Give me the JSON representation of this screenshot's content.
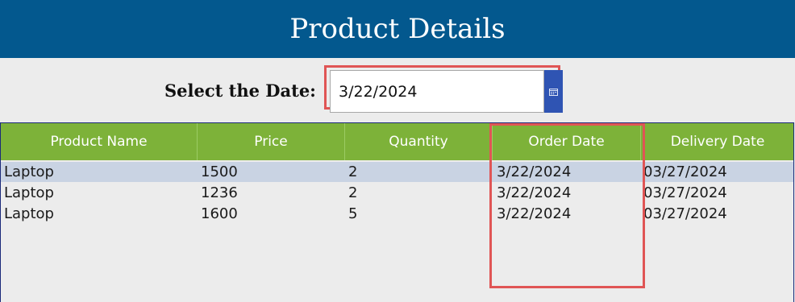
{
  "header": {
    "title": "Product Details"
  },
  "date_filter": {
    "label": "Select the Date:",
    "value": "3/22/2024"
  },
  "grid": {
    "columns": [
      "Product Name",
      "Price",
      "Quantity",
      "Order Date",
      "Delivery Date"
    ],
    "rows": [
      [
        "Laptop",
        "1500",
        "2",
        "3/22/2024",
        "03/27/2024"
      ],
      [
        "Laptop",
        "1236",
        "2",
        "3/22/2024",
        "03/27/2024"
      ],
      [
        "Laptop",
        "1600",
        "5",
        "3/22/2024",
        "03/27/2024"
      ]
    ]
  },
  "colors": {
    "header_bg": "#03588e",
    "grid_header_bg": "#7db239",
    "selected_row_bg": "#c9d3e3",
    "highlight_border": "#e05555",
    "calendar_button_bg": "#2f54b3"
  },
  "icons": {
    "calendar": "calendar-icon"
  }
}
